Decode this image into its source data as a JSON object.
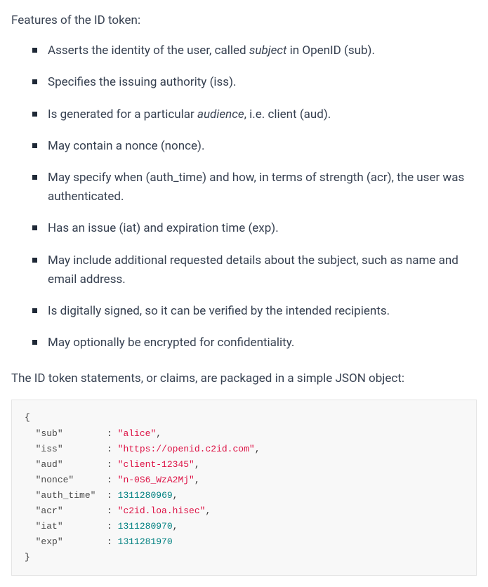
{
  "intro": "Features of the ID token:",
  "features": [
    {
      "pre": "Asserts the identity of the user, called ",
      "italic": "subject",
      "post": " in OpenID (sub)."
    },
    {
      "pre": "Specifies the issuing authority (iss).",
      "italic": "",
      "post": ""
    },
    {
      "pre": "Is generated for a particular ",
      "italic": "audience",
      "post": ", i.e. client (aud)."
    },
    {
      "pre": "May contain a nonce (nonce).",
      "italic": "",
      "post": ""
    },
    {
      "pre": "May specify when (auth_time) and how, in terms of strength (acr), the user was authenticated.",
      "italic": "",
      "post": ""
    },
    {
      "pre": "Has an issue (iat) and expiration time (exp).",
      "italic": "",
      "post": ""
    },
    {
      "pre": "May include additional requested details about the subject, such as name and email address.",
      "italic": "",
      "post": ""
    },
    {
      "pre": "Is digitally signed, so it can be verified by the intended recipients.",
      "italic": "",
      "post": ""
    },
    {
      "pre": "May optionally be encrypted for confidentiality.",
      "italic": "",
      "post": ""
    }
  ],
  "claimsIntro": "The ID token statements, or claims, are packaged in a simple JSON object:",
  "code": {
    "open": "{",
    "close": "}",
    "rows": [
      {
        "key": "\"sub\"",
        "pad": "       ",
        "valPrefix": " : ",
        "value": "\"alice\"",
        "type": "string",
        "comma": ","
      },
      {
        "key": "\"iss\"",
        "pad": "       ",
        "valPrefix": " : ",
        "value": "\"https://openid.c2id.com\"",
        "type": "string",
        "comma": ","
      },
      {
        "key": "\"aud\"",
        "pad": "       ",
        "valPrefix": " : ",
        "value": "\"client-12345\"",
        "type": "string",
        "comma": ","
      },
      {
        "key": "\"nonce\"",
        "pad": "     ",
        "valPrefix": " : ",
        "value": "\"n-0S6_WzA2Mj\"",
        "type": "string",
        "comma": ","
      },
      {
        "key": "\"auth_time\"",
        "pad": " ",
        "valPrefix": " : ",
        "value": "1311280969",
        "type": "number",
        "comma": ","
      },
      {
        "key": "\"acr\"",
        "pad": "       ",
        "valPrefix": " : ",
        "value": "\"c2id.loa.hisec\"",
        "type": "string",
        "comma": ","
      },
      {
        "key": "\"iat\"",
        "pad": "       ",
        "valPrefix": " : ",
        "value": "1311280970",
        "type": "number",
        "comma": ","
      },
      {
        "key": "\"exp\"",
        "pad": "       ",
        "valPrefix": " : ",
        "value": "1311281970",
        "type": "number",
        "comma": ""
      }
    ]
  }
}
